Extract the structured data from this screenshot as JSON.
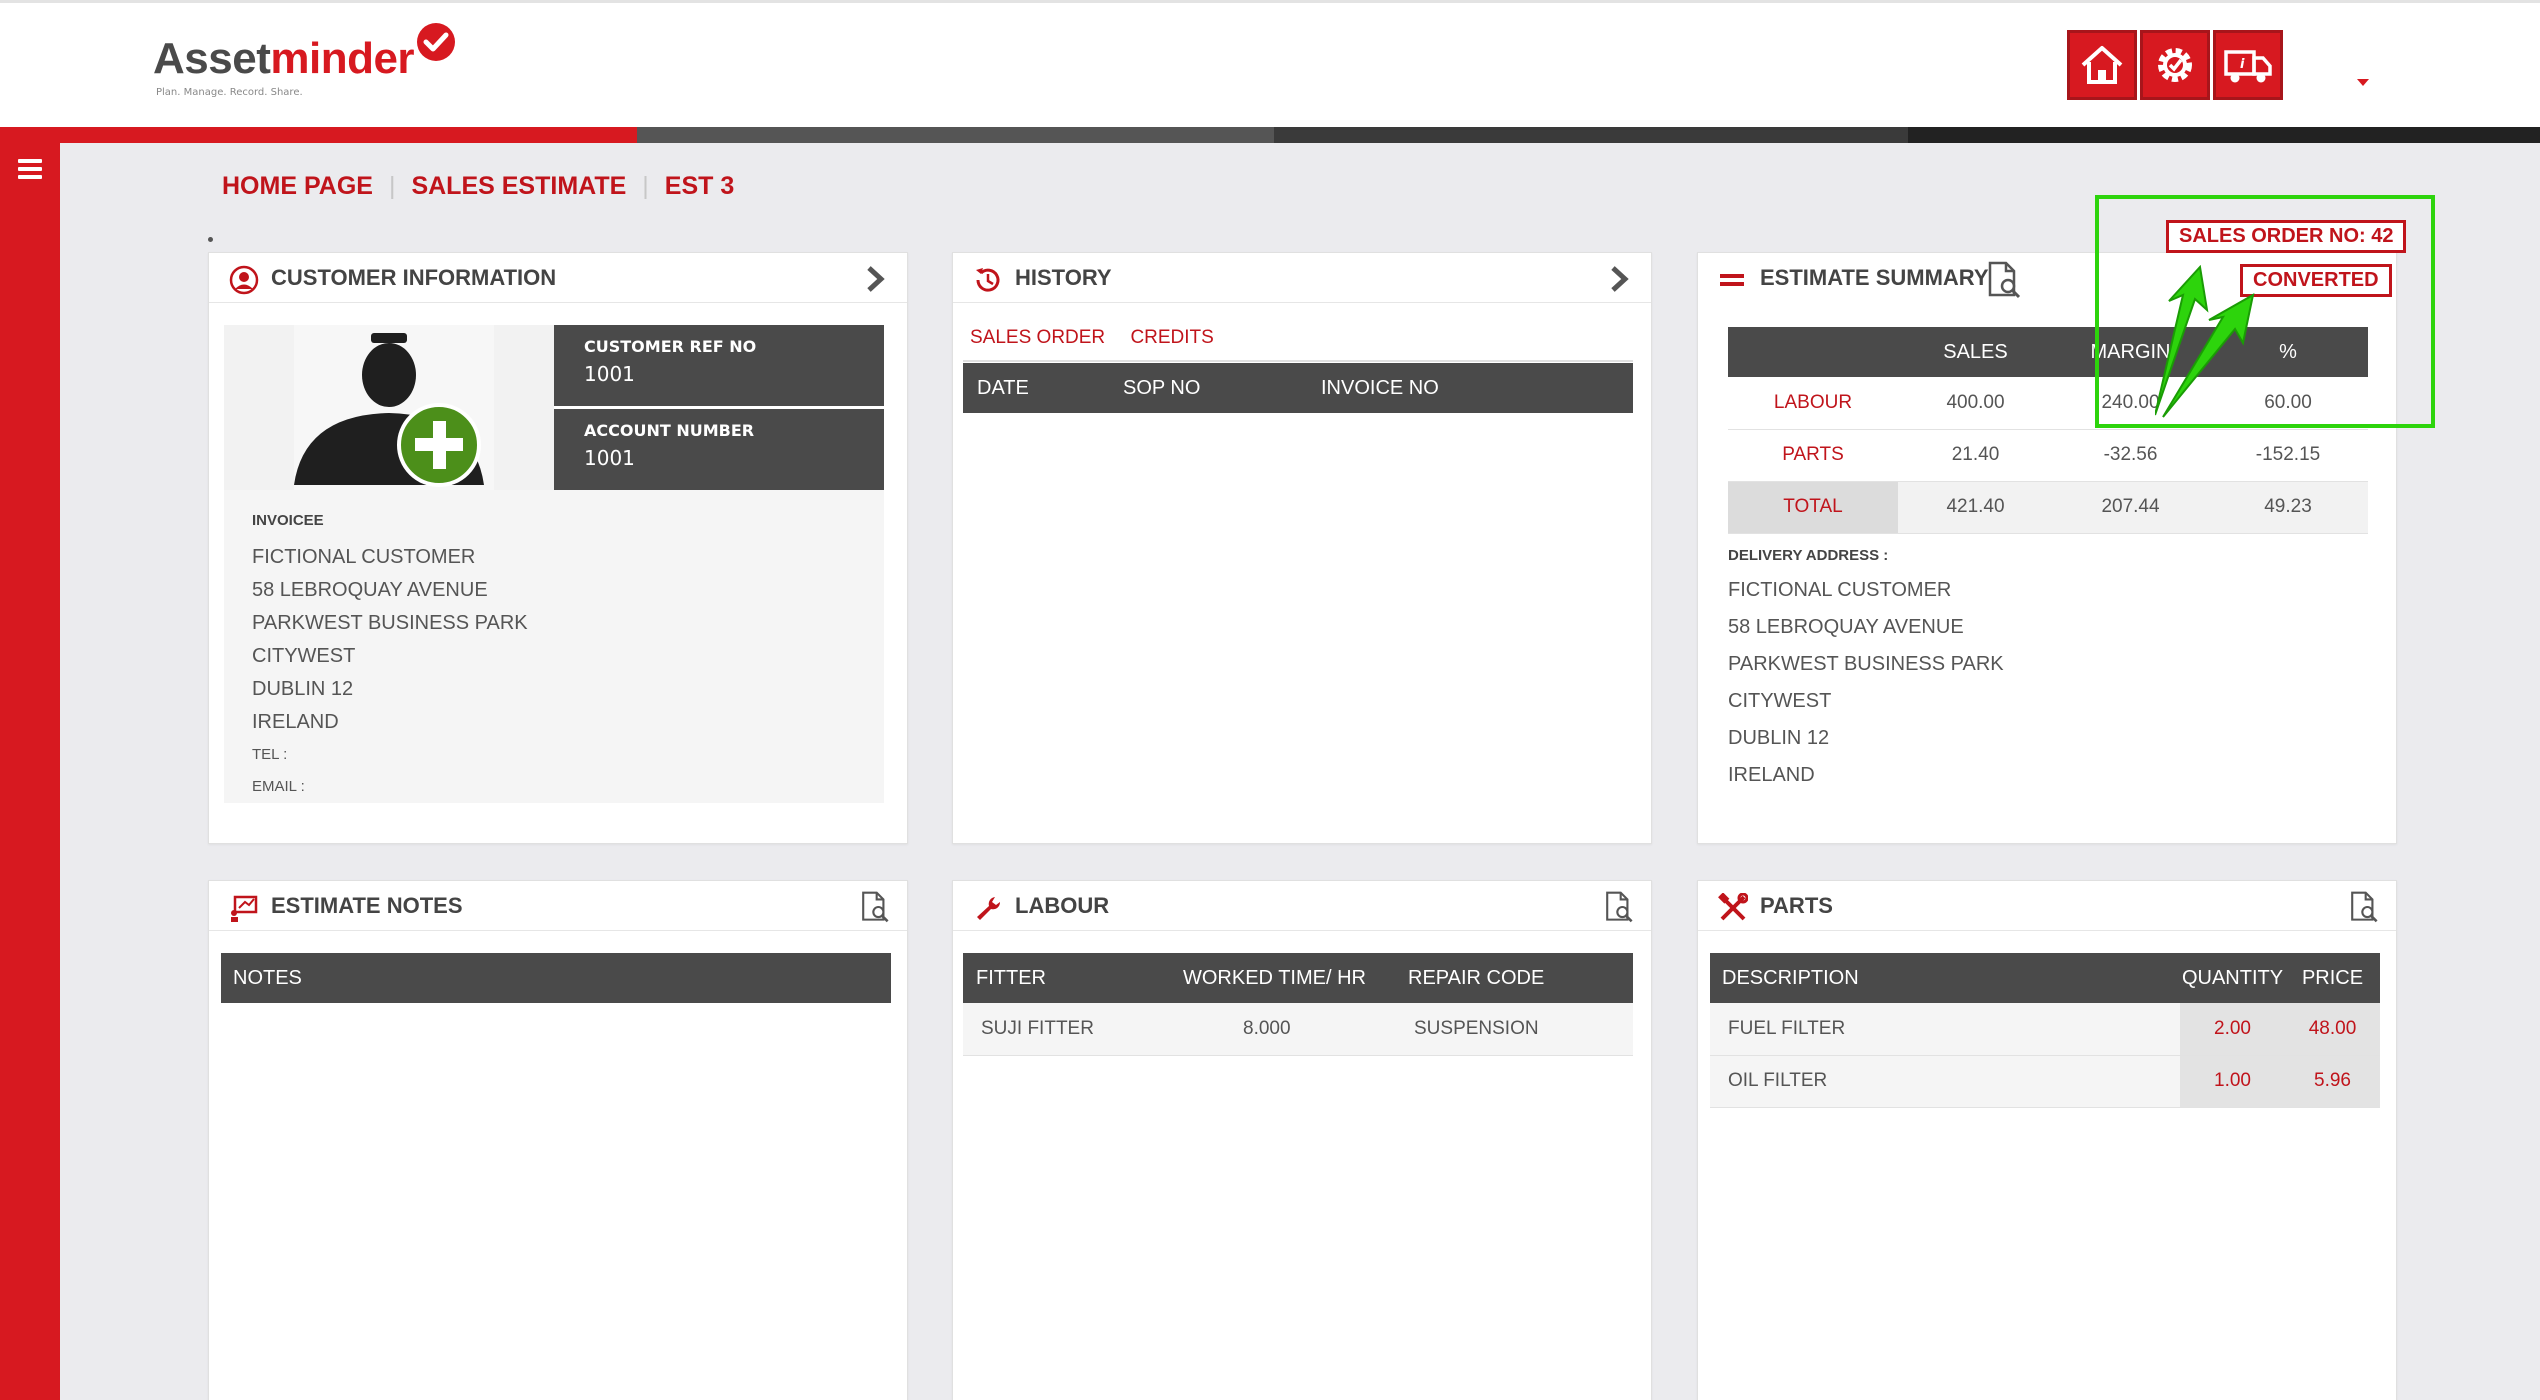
{
  "brand": {
    "name_part1": "Asset",
    "name_part2": "minder",
    "tagline": "Plan. Manage. Record. Share.",
    "accent": "#d71920"
  },
  "header": {
    "buttons": [
      {
        "name": "home-icon"
      },
      {
        "name": "settings-gear-icon"
      },
      {
        "name": "delivery-truck-icon"
      }
    ]
  },
  "strip_colors": [
    "#d71920",
    "#555555",
    "#3a3a3a",
    "#222222"
  ],
  "breadcrumb": {
    "home": "HOME PAGE",
    "section": "SALES ESTIMATE",
    "current": "EST 3"
  },
  "status": {
    "sales_order": "SALES ORDER NO: 42",
    "state": "CONVERTED"
  },
  "customer_info": {
    "title": "CUSTOMER INFORMATION",
    "ref_label": "CUSTOMER REF NO",
    "ref_value": "1001",
    "account_label": "ACCOUNT NUMBER",
    "account_value": "1001",
    "invoicee_label": "INVOICEE",
    "invoicee_lines": [
      "FICTIONAL CUSTOMER",
      "58 LEBROQUAY AVENUE",
      "PARKWEST BUSINESS PARK",
      "CITYWEST",
      "DUBLIN 12",
      "IRELAND"
    ],
    "tel_label": "TEL :",
    "email_label": "EMAIL :"
  },
  "history": {
    "title": "HISTORY",
    "tabs": [
      "SALES ORDER",
      "CREDITS"
    ],
    "columns": [
      "DATE",
      "SOP NO",
      "INVOICE NO"
    ]
  },
  "estimate_summary": {
    "title": "ESTIMATE SUMMARY",
    "columns": [
      "",
      "SALES",
      "MARGIN",
      "%"
    ],
    "rows": [
      {
        "label": "LABOUR",
        "sales": "400.00",
        "margin": "240.00",
        "pct": "60.00"
      },
      {
        "label": "PARTS",
        "sales": "21.40",
        "margin": "-32.56",
        "pct": "-152.15"
      },
      {
        "label": "TOTAL",
        "sales": "421.40",
        "margin": "207.44",
        "pct": "49.23"
      }
    ],
    "delivery_label": "DELIVERY ADDRESS :",
    "delivery_lines": [
      "FICTIONAL CUSTOMER",
      "58 LEBROQUAY AVENUE",
      "PARKWEST BUSINESS PARK",
      "CITYWEST",
      "DUBLIN 12",
      "IRELAND"
    ]
  },
  "estimate_notes": {
    "title": "ESTIMATE NOTES",
    "column": "NOTES"
  },
  "labour": {
    "title": "LABOUR",
    "columns": [
      "FITTER",
      "WORKED TIME/ HR",
      "REPAIR CODE"
    ],
    "rows": [
      {
        "fitter": "SUJI FITTER",
        "time": "8.000",
        "code": "SUSPENSION"
      }
    ]
  },
  "parts": {
    "title": "PARTS",
    "columns": [
      "DESCRIPTION",
      "QUANTITY",
      "PRICE"
    ],
    "rows": [
      {
        "description": "FUEL FILTER",
        "quantity": "2.00",
        "price": "48.00"
      },
      {
        "description": "OIL FILTER",
        "quantity": "1.00",
        "price": "5.96"
      }
    ]
  }
}
